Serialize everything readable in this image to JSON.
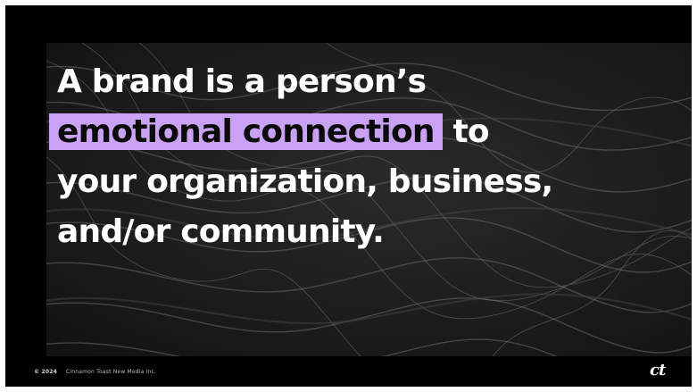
{
  "slide": {
    "quote": {
      "line1": "A brand is a person’s",
      "highlight": "emotional connection",
      "line2_rest": " to",
      "line3": "your organization, business,",
      "line4": "and/or community."
    },
    "footer": {
      "year": "© 2024",
      "company": "Cinnamon Toast New Media Inc."
    },
    "logo_text": "ct",
    "colors": {
      "highlight": "#c9a2f4",
      "background": "#000000",
      "text": "#ffffff"
    }
  }
}
